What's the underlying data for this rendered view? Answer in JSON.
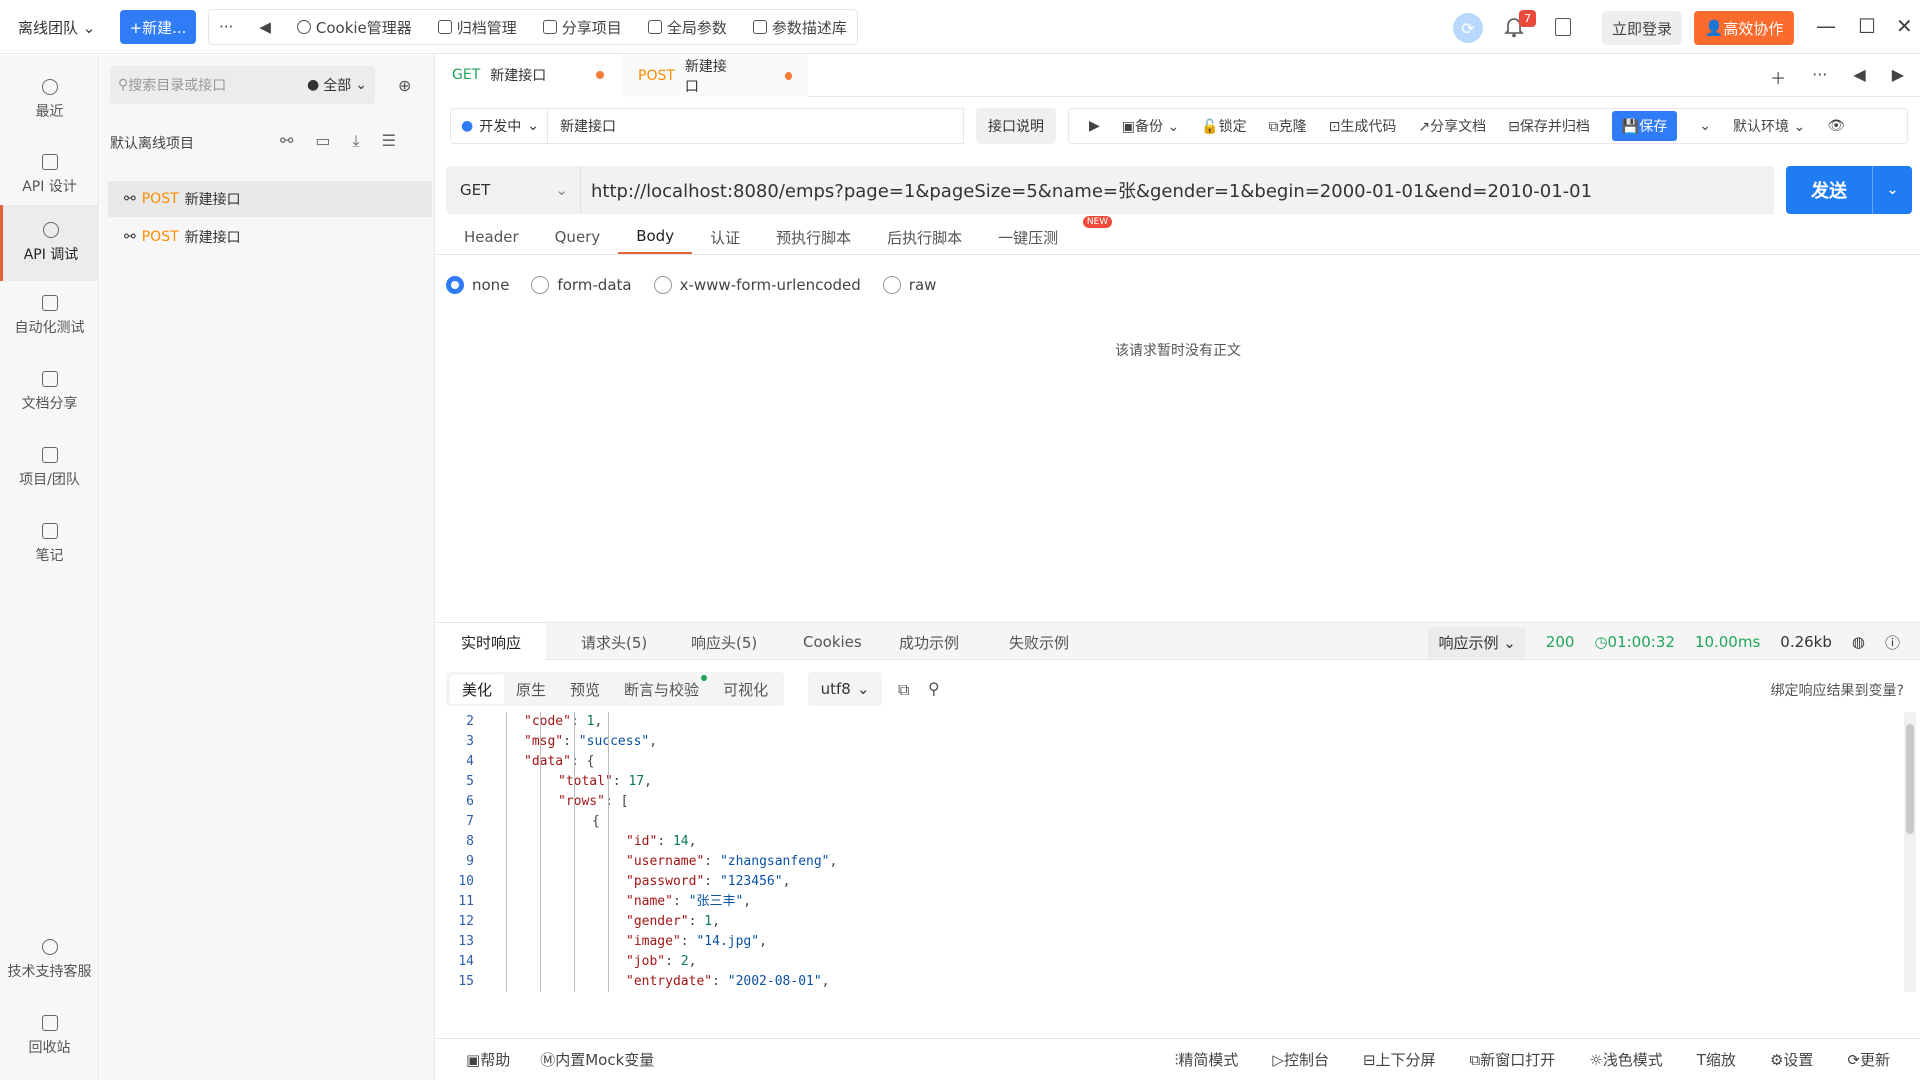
{
  "header": {
    "team": "离线团队",
    "new_button": "+新建...",
    "more": "···",
    "tools": [
      "Cookie管理器",
      "归档管理",
      "分享项目",
      "全局参数",
      "参数描述库"
    ],
    "notification_count": "7",
    "login_button": "立即登录",
    "collab_button": "高效协作"
  },
  "rail": {
    "items": [
      "最近",
      "API 设计",
      "API 调试",
      "自动化测试",
      "文档分享",
      "项目/团队",
      "笔记"
    ],
    "bottom_items": [
      "技术支持客服",
      "回收站"
    ]
  },
  "tree": {
    "search_placeholder": "搜索目录或接口",
    "filter": "全部",
    "project": "默认离线项目",
    "items": [
      {
        "method": "POST",
        "name": "新建接口"
      },
      {
        "method": "POST",
        "name": "新建接口"
      }
    ]
  },
  "tabs": [
    {
      "method": "GET",
      "name": "新建接口"
    },
    {
      "method": "POST",
      "name": "新建接口"
    }
  ],
  "request": {
    "status": "开发中",
    "name": "新建接口",
    "desc_button": "接口说明",
    "actions": [
      "备份",
      "锁定",
      "克隆",
      "生成代码",
      "分享文档",
      "保存并归档",
      "保存"
    ],
    "env": "默认环境",
    "method": "GET",
    "url": "http://localhost:8080/emps?page=1&pageSize=5&name=张&gender=1&begin=2000-01-01&end=2010-01-01",
    "send_button": "发送",
    "tabs": [
      "Header",
      "Query",
      "Body",
      "认证",
      "预执行脚本",
      "后执行脚本",
      "一键压测"
    ],
    "new_badge": "NEW",
    "body_types": [
      "none",
      "form-data",
      "x-www-form-urlencoded",
      "raw"
    ],
    "empty_body": "该请求暂时没有正文"
  },
  "response": {
    "tabs": [
      "实时响应",
      "请求头(5)",
      "响应头(5)",
      "Cookies",
      "成功示例",
      "失败示例"
    ],
    "example_select": "响应示例",
    "status_code": "200",
    "time": "01:00:32",
    "duration": "10.00ms",
    "size": "0.26kb",
    "view_tabs": [
      "美化",
      "原生",
      "预览",
      "断言与校验",
      "可视化"
    ],
    "encoding": "utf8",
    "bind_var": "绑定响应结果到变量?",
    "code_lines": [
      {
        "n": "2",
        "indent": 0,
        "k": "\"code\"",
        "v": "1",
        "t": "num",
        "tail": ","
      },
      {
        "n": "3",
        "indent": 0,
        "k": "\"msg\"",
        "v": "\"success\"",
        "t": "str",
        "tail": ","
      },
      {
        "n": "4",
        "indent": 0,
        "k": "\"data\"",
        "v": "{",
        "t": "plain",
        "tail": ""
      },
      {
        "n": "5",
        "indent": 1,
        "k": "\"total\"",
        "v": "17",
        "t": "num",
        "tail": ","
      },
      {
        "n": "6",
        "indent": 1,
        "k": "\"rows\"",
        "v": "[",
        "t": "plain",
        "tail": ""
      },
      {
        "n": "7",
        "indent": 2,
        "k": "",
        "v": "{",
        "t": "plain",
        "tail": ""
      },
      {
        "n": "8",
        "indent": 3,
        "k": "\"id\"",
        "v": "14",
        "t": "num",
        "tail": ","
      },
      {
        "n": "9",
        "indent": 3,
        "k": "\"username\"",
        "v": "\"zhangsanfeng\"",
        "t": "str",
        "tail": ","
      },
      {
        "n": "10",
        "indent": 3,
        "k": "\"password\"",
        "v": "\"123456\"",
        "t": "str",
        "tail": ","
      },
      {
        "n": "11",
        "indent": 3,
        "k": "\"name\"",
        "v": "\"张三丰\"",
        "t": "str",
        "tail": ","
      },
      {
        "n": "12",
        "indent": 3,
        "k": "\"gender\"",
        "v": "1",
        "t": "num",
        "tail": ","
      },
      {
        "n": "13",
        "indent": 3,
        "k": "\"image\"",
        "v": "\"14.jpg\"",
        "t": "str",
        "tail": ","
      },
      {
        "n": "14",
        "indent": 3,
        "k": "\"job\"",
        "v": "2",
        "t": "num",
        "tail": ","
      },
      {
        "n": "15",
        "indent": 3,
        "k": "\"entrydate\"",
        "v": "\"2002-08-01\"",
        "t": "str",
        "tail": ","
      }
    ]
  },
  "footer": {
    "left": [
      "帮助",
      "内置Mock变量"
    ],
    "right": [
      "精简模式",
      "控制台",
      "上下分屏",
      "新窗口打开",
      "浅色模式",
      "缩放",
      "设置",
      "更新"
    ]
  },
  "colors": {
    "accent": "#2f7cf6",
    "orange": "#fb6b2d",
    "post": "#ff8a00",
    "get": "#22a559"
  }
}
